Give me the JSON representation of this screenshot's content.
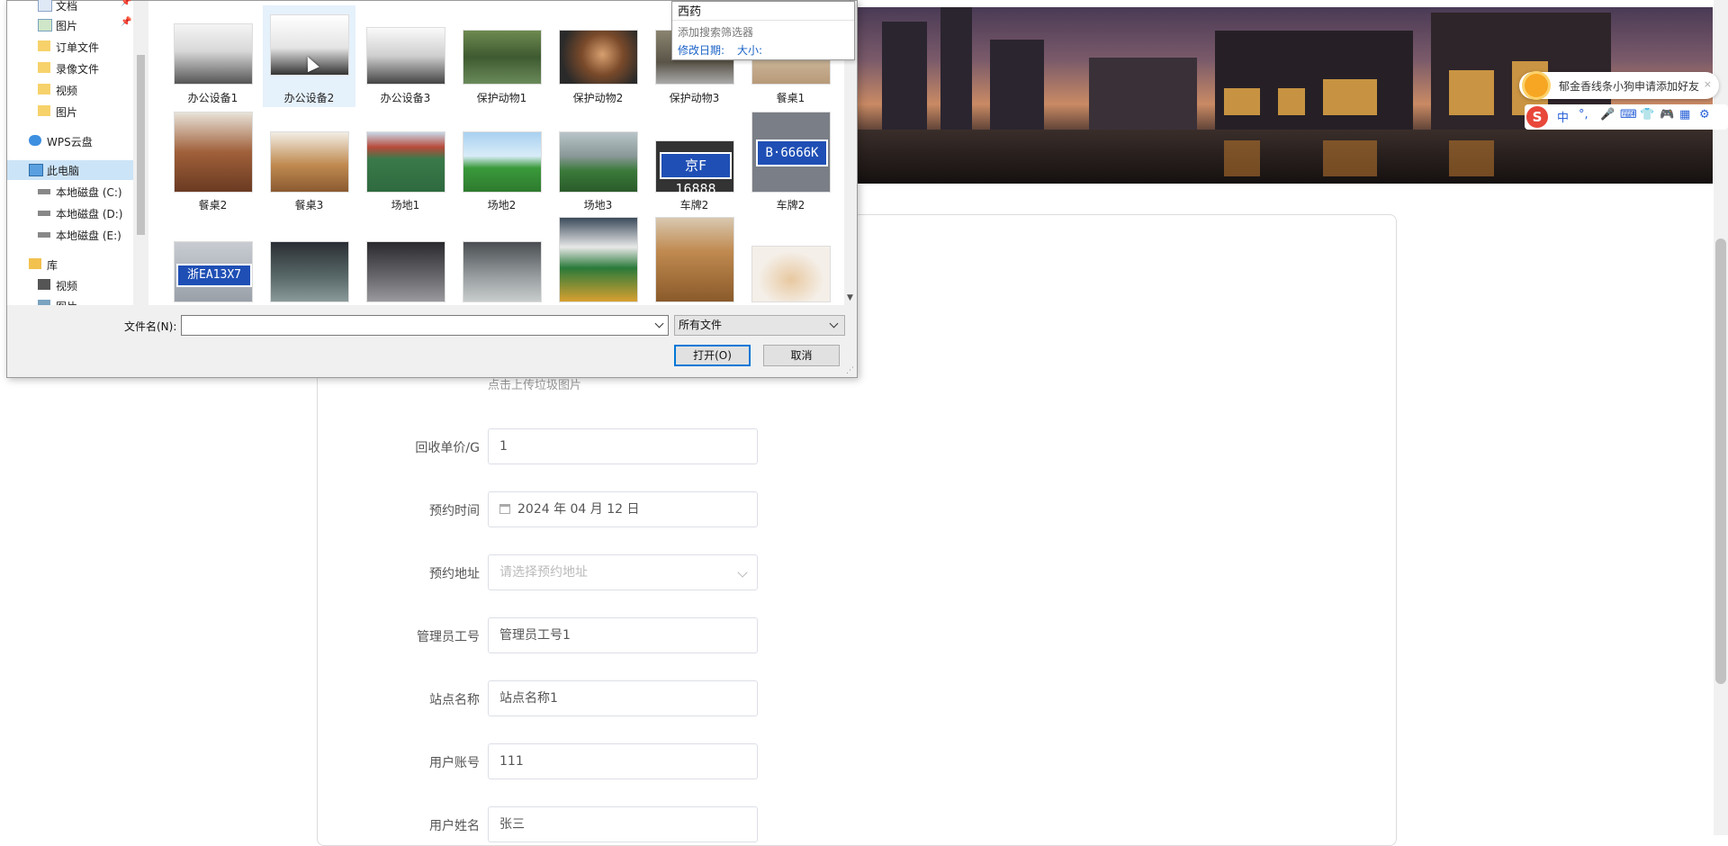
{
  "dialog": {
    "nav": [
      {
        "label": "文档",
        "icon": "document-icon",
        "pinned": true
      },
      {
        "label": "图片",
        "icon": "pictures-icon",
        "pinned": true
      },
      {
        "label": "订单文件",
        "icon": "folder-icon"
      },
      {
        "label": "录像文件",
        "icon": "folder-icon"
      },
      {
        "label": "视频",
        "icon": "folder-icon"
      },
      {
        "label": "图片",
        "icon": "folder-icon"
      },
      {
        "label": "WPS云盘",
        "icon": "cloud-icon"
      },
      {
        "label": "此电脑",
        "icon": "computer-icon",
        "selected": true
      },
      {
        "label": "本地磁盘 (C:)",
        "icon": "drive-icon"
      },
      {
        "label": "本地磁盘 (D:)",
        "icon": "drive-icon"
      },
      {
        "label": "本地磁盘 (E:)",
        "icon": "drive-icon"
      },
      {
        "label": "库",
        "icon": "library-icon"
      },
      {
        "label": "视频",
        "icon": "video-library-icon"
      },
      {
        "label": "图片",
        "icon": "pictures-icon"
      }
    ],
    "files": [
      {
        "label": "办公设备1"
      },
      {
        "label": "办公设备2",
        "selected": true
      },
      {
        "label": "办公设备3"
      },
      {
        "label": "保护动物1"
      },
      {
        "label": "保护动物2"
      },
      {
        "label": "保护动物3"
      },
      {
        "label": "餐桌1"
      },
      {
        "label": "餐桌2"
      },
      {
        "label": "餐桌3"
      },
      {
        "label": "场地1"
      },
      {
        "label": "场地2"
      },
      {
        "label": "场地3"
      },
      {
        "label": "车牌2",
        "plate_text": "京F 16888"
      },
      {
        "label": "车牌2",
        "plate_text": "B·6666K"
      },
      {
        "label": "",
        "plate_text": "浙EA13X7"
      },
      {
        "label": ""
      },
      {
        "label": ""
      },
      {
        "label": ""
      },
      {
        "label": ""
      },
      {
        "label": ""
      },
      {
        "label": ""
      }
    ],
    "search_popup": {
      "query": "西药",
      "hint": "添加搜索筛选器",
      "filter_date": "修改日期:",
      "filter_size": "大小:"
    },
    "filename_label": "文件名(N):",
    "filename_value": "",
    "filetype_value": "所有文件",
    "open_button": "打开(O)",
    "cancel_button": "取消"
  },
  "page": {
    "upload_hint": "点击上传垃圾图片",
    "form": [
      {
        "label": "回收单价/G",
        "value": "1"
      },
      {
        "label": "预约时间",
        "value": "2024 年 04 月 12 日",
        "icon": "calendar-icon"
      },
      {
        "label": "预约地址",
        "value": "请选择预约地址",
        "placeholder": true,
        "dropdown": true
      },
      {
        "label": "管理员工号",
        "value": "管理员工号1"
      },
      {
        "label": "站点名称",
        "value": "站点名称1"
      },
      {
        "label": "用户账号",
        "value": "111"
      },
      {
        "label": "用户姓名",
        "value": "张三"
      }
    ]
  },
  "ime": {
    "notification": "郁金香线条小狗申请添加好友",
    "close": "×",
    "logo": "S",
    "mode": "中",
    "punct": "°,"
  }
}
